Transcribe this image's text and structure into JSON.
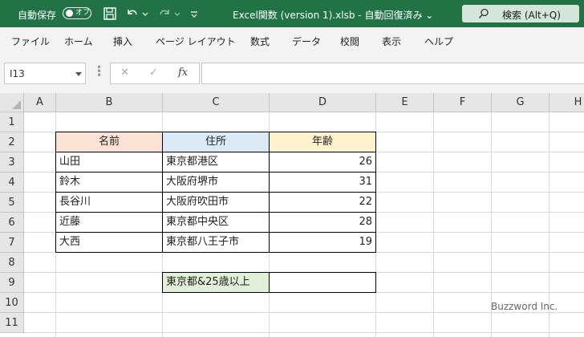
{
  "titlebar": {
    "autosave_label": "自動保存",
    "autosave_state": "オフ",
    "doc_title": "Excel関数 (version 1).xlsb  -  自動回復済み  ⌄",
    "search_placeholder": "検索 (Alt+Q)"
  },
  "ribbon": {
    "tabs": [
      "ファイル",
      "ホーム",
      "挿入",
      "ページ レイアウト",
      "数式",
      "データ",
      "校閲",
      "表示",
      "ヘルプ"
    ]
  },
  "formula_bar": {
    "name_box": "I13",
    "cancel": "✕",
    "enter": "✓",
    "fx": "fx",
    "content": ""
  },
  "sheet": {
    "columns": [
      "A",
      "B",
      "C",
      "D",
      "E",
      "F",
      "G",
      "H"
    ],
    "rows": [
      "1",
      "2",
      "3",
      "4",
      "5",
      "6",
      "7",
      "8",
      "9",
      "10",
      "11"
    ],
    "table": {
      "headers": [
        "名前",
        "住所",
        "年齢"
      ],
      "rows": [
        [
          "山田",
          "東京都港区",
          "26"
        ],
        [
          "鈴木",
          "大阪府堺市",
          "31"
        ],
        [
          "長谷川",
          "大阪府吹田市",
          "22"
        ],
        [
          "近藤",
          "東京都中央区",
          "28"
        ],
        [
          "大西",
          "東京都八王子市",
          "19"
        ]
      ]
    },
    "criteria_label": "東京都&25歳以上",
    "criteria_result": ""
  },
  "watermark": "Buzzword Inc.",
  "colors": {
    "title_bg": "#217346",
    "ribbon_bg": "#f3f3f3",
    "header_name": "#fbe2d5",
    "header_addr": "#dbeaf7",
    "header_age": "#fff2cc",
    "criteria_fill": "#e2efd9"
  }
}
